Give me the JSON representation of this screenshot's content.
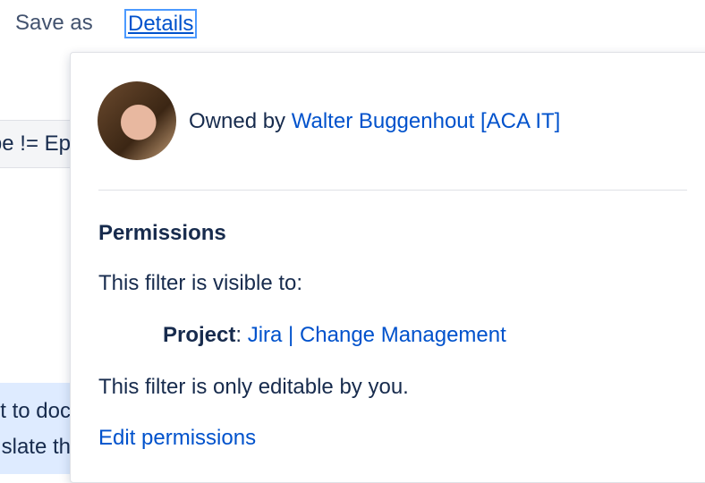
{
  "toolbar": {
    "save_as_label": "Save as",
    "details_label": "Details"
  },
  "background": {
    "query_fragment": "pe != Ep",
    "info_line_1": "t to doc",
    "info_line_2": "slate th"
  },
  "details_popup": {
    "owner_prefix": "Owned by ",
    "owner_name": "Walter Buggenhout [ACA IT]",
    "permissions_heading": "Permissions",
    "visible_to_text": "This filter is visible to:",
    "share": {
      "label": "Project",
      "separator": ": ",
      "value": "Jira | Change Management"
    },
    "editable_text": "This filter is only editable by you.",
    "edit_permissions_label": "Edit permissions"
  }
}
